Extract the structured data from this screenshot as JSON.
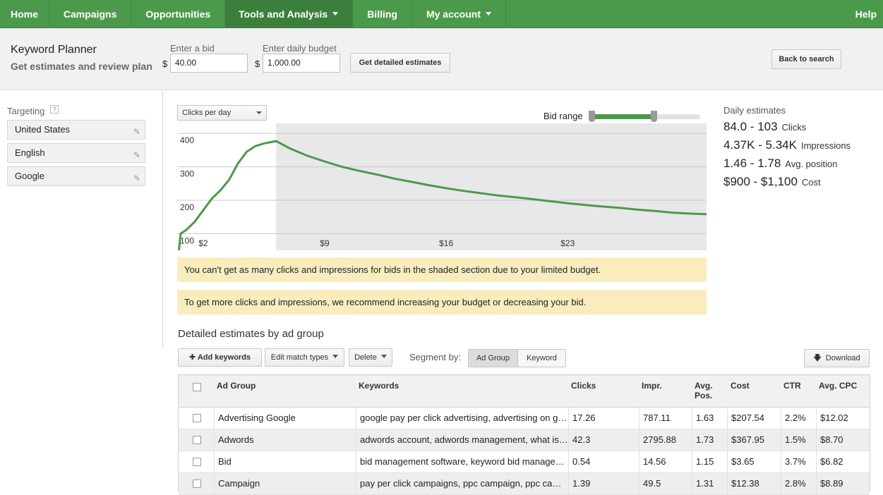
{
  "nav": {
    "items": [
      "Home",
      "Campaigns",
      "Opportunities",
      "Tools and Analysis",
      "Billing",
      "My account"
    ],
    "help": "Help"
  },
  "header": {
    "title": "Keyword Planner",
    "subtitle": "Get estimates and review plan",
    "bid_label": "Enter a bid",
    "bid_currency": "$",
    "bid_value": "40.00",
    "budget_label": "Enter daily budget",
    "budget_currency": "$",
    "budget_value": "1,000.00",
    "estimate_button": "Get detailed estimates",
    "back_button": "Back to search"
  },
  "targeting": {
    "label": "Targeting",
    "help": "?",
    "items": [
      "United States",
      "English",
      "Google"
    ]
  },
  "chart_controls": {
    "metric": "Clicks per day",
    "bid_range_label": "Bid range"
  },
  "chart_data": {
    "type": "line",
    "yticks": [
      "400",
      "300",
      "200",
      "100"
    ],
    "xticks": [
      "$2",
      "$9",
      "$16",
      "$23"
    ],
    "ylim": [
      50,
      430
    ],
    "xlim": [
      0.5,
      31
    ],
    "shaded_from_x": 6.2,
    "x": [
      0.6,
      0.7,
      1.0,
      1.5,
      2.0,
      2.5,
      3.0,
      3.5,
      4.0,
      4.5,
      5.0,
      5.5,
      6.0,
      6.2,
      7,
      8,
      9,
      10,
      11,
      12,
      13,
      14,
      15,
      16,
      17,
      18,
      19,
      20,
      21,
      22,
      23,
      24,
      25,
      26,
      27,
      28,
      29,
      30,
      31
    ],
    "y": [
      50,
      100,
      110,
      135,
      170,
      205,
      230,
      262,
      310,
      345,
      362,
      370,
      375,
      377,
      355,
      333,
      316,
      300,
      288,
      277,
      265,
      255,
      245,
      236,
      228,
      221,
      214,
      209,
      203,
      197,
      191,
      186,
      181,
      177,
      172,
      168,
      163,
      160,
      158
    ],
    "grid": true
  },
  "daily_estimates": {
    "title": "Daily estimates",
    "rows": [
      {
        "value": "84.0 - 103",
        "unit": "Clicks"
      },
      {
        "value": "4.37K - 5.34K",
        "unit": "Impressions"
      },
      {
        "value": "1.46 - 1.78",
        "unit": "Avg. position"
      },
      {
        "value": "$900 - $1,100",
        "unit": "Cost"
      }
    ]
  },
  "notices": [
    "You can't get as many clicks and impressions for bids in the shaded section due to your limited budget.",
    "To get more clicks and impressions, we recommend increasing your budget or decreasing your bid."
  ],
  "details": {
    "title": "Detailed estimates by ad group",
    "add_keywords": "Add keywords",
    "edit_match_types": "Edit match types",
    "delete": "Delete",
    "segment_label": "Segment by:",
    "segment_options": [
      "Ad Group",
      "Keyword"
    ],
    "download": "Download",
    "columns": [
      "Ad Group",
      "Keywords",
      "Clicks",
      "Impr.",
      "Avg. Pos.",
      "Cost",
      "CTR",
      "Avg. CPC"
    ],
    "rows": [
      [
        "Advertising Google",
        "google pay per click advertising, advertising on google",
        "17.26",
        "787.11",
        "1.63",
        "$207.54",
        "2.2%",
        "$12.02"
      ],
      [
        "Adwords",
        "adwords account, adwords management, what is adwords",
        "42.3",
        "2795.88",
        "1.73",
        "$367.95",
        "1.5%",
        "$8.70"
      ],
      [
        "Bid",
        "bid management software, keyword bid management",
        "0.54",
        "14.56",
        "1.15",
        "$3.65",
        "3.7%",
        "$6.82"
      ],
      [
        "Campaign",
        "pay per click campaigns, ppc campaign, ppc campaign management",
        "1.39",
        "49.5",
        "1.31",
        "$12.38",
        "2.8%",
        "$8.89"
      ]
    ]
  }
}
